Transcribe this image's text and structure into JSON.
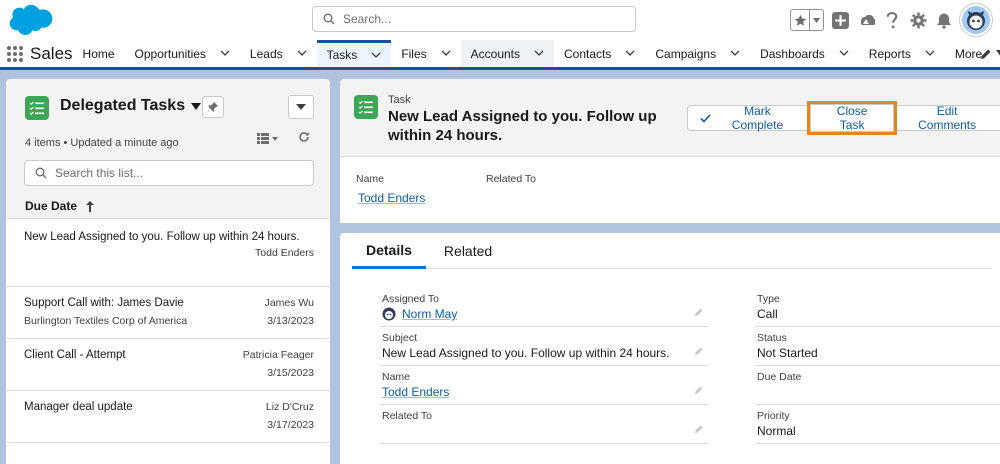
{
  "header": {
    "search_placeholder": "Search..."
  },
  "nav": {
    "app_name": "Sales",
    "items": [
      {
        "label": "Home",
        "chevron": false
      },
      {
        "label": "Opportunities",
        "chevron": true
      },
      {
        "label": "Leads",
        "chevron": true
      },
      {
        "label": "Tasks",
        "chevron": true,
        "active": true
      },
      {
        "label": "Files",
        "chevron": true
      },
      {
        "label": "Accounts",
        "chevron": true,
        "hover": true
      },
      {
        "label": "Contacts",
        "chevron": true
      },
      {
        "label": "Campaigns",
        "chevron": true
      },
      {
        "label": "Dashboards",
        "chevron": true
      },
      {
        "label": "Reports",
        "chevron": true
      },
      {
        "label": "More",
        "chevron": true
      }
    ]
  },
  "list": {
    "title": "Delegated Tasks",
    "meta": "4 items • Updated a minute ago",
    "search_placeholder": "Search this list...",
    "sort_label": "Due Date",
    "rows": [
      {
        "title": "New Lead Assigned to you. Follow up within 24 hours.",
        "sub": "",
        "right1": "",
        "right2": "Todd Enders"
      },
      {
        "title": "Support Call with: James Davie",
        "sub": "Burlington Textiles Corp of America",
        "right1": "James Wu",
        "right2": "3/13/2023"
      },
      {
        "title": "Client Call - Attempt",
        "sub": "",
        "right1": "Patricia Feager",
        "right2": "3/15/2023"
      },
      {
        "title": "Manager deal update",
        "sub": "",
        "right1": "Liz D'Cruz",
        "right2": "3/17/2023"
      }
    ]
  },
  "record": {
    "type_label": "Task",
    "title": "New Lead Assigned to you. Follow up within 24 hours.",
    "actions": {
      "mark_complete": "Mark Complete",
      "close_task": "Close Task",
      "edit_comments": "Edit Comments"
    },
    "highlights": {
      "name_label": "Name",
      "name_value": "Todd Enders",
      "related_label": "Related To",
      "related_value": ""
    }
  },
  "details": {
    "tabs": [
      "Details",
      "Related"
    ],
    "left": [
      {
        "label": "Assigned To",
        "value": "Norm May",
        "link": true,
        "avatar": true
      },
      {
        "label": "Subject",
        "value": "New Lead Assigned to you. Follow up within 24 hours.",
        "link": false
      },
      {
        "label": "Name",
        "value": "Todd Enders",
        "link": true
      },
      {
        "label": "Related To",
        "value": "",
        "link": false
      }
    ],
    "right": [
      {
        "label": "Type",
        "value": "Call"
      },
      {
        "label": "Status",
        "value": "Not Started"
      },
      {
        "label": "Due Date",
        "value": ""
      },
      {
        "label": "Priority",
        "value": "Normal"
      }
    ]
  },
  "colors": {
    "brand_blue": "#1b5297",
    "link_blue": "#0b5cab",
    "task_green": "#3ba755",
    "highlight_orange": "#e08a1d",
    "background": "#b0c4df"
  }
}
